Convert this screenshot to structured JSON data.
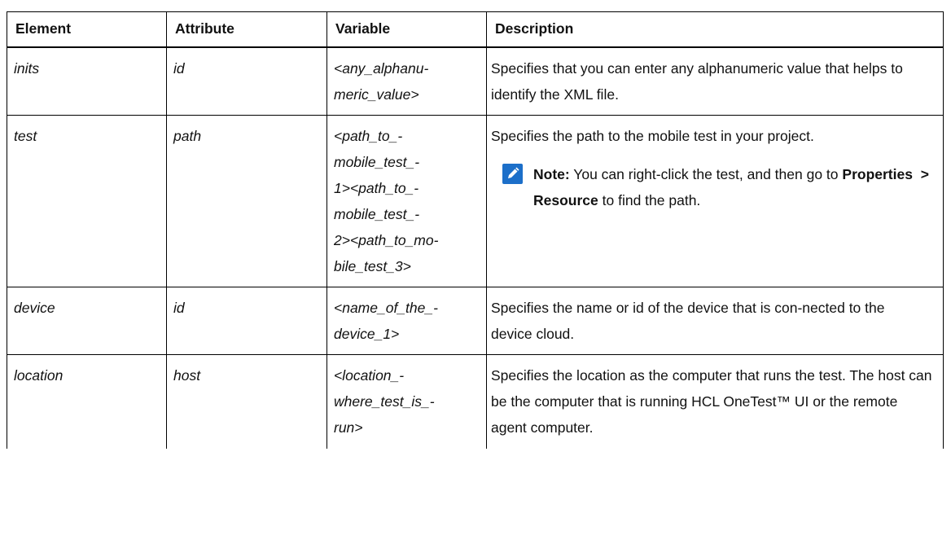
{
  "headers": [
    "Element",
    "Attribute",
    "Variable",
    "Description"
  ],
  "rows": [
    {
      "element": "inits",
      "attribute": "id",
      "variable": [
        "<any_alphanu-",
        "meric_value>"
      ],
      "description": "Specifies that you can enter any alphanumeric value that helps to identify the XML file."
    },
    {
      "element": "test",
      "attribute": "path",
      "variable": [
        "<path_to_-",
        "mobile_test_-",
        "1><path_to_-",
        "mobile_test_-",
        "2><path_to_mo-",
        "bile_test_3>"
      ],
      "description": "Specifies the path to the mobile test in your project.",
      "note": {
        "icon": "pencil-note-icon",
        "label": "Note:",
        "text_before": "You can right-click the test, and then go to",
        "menu_path_1": "Properties",
        "separator": ">",
        "menu_path_2": "Resource",
        "text_after": "to find the path."
      }
    },
    {
      "element": "device",
      "attribute": "id",
      "variable": [
        "<name_of_the_-",
        "device_1>"
      ],
      "description": "Specifies the name or id of the device that is con-nected to the device cloud."
    },
    {
      "element": "location",
      "attribute": "host",
      "variable": [
        "<location_-",
        "where_test_is_-",
        "run>"
      ],
      "description": "Specifies the location as the computer that runs the test. The host can be the computer that is running HCL OneTest™ UI or the remote agent computer."
    }
  ],
  "colors": {
    "note_icon": "#1c6fc9",
    "border": "#000000"
  }
}
